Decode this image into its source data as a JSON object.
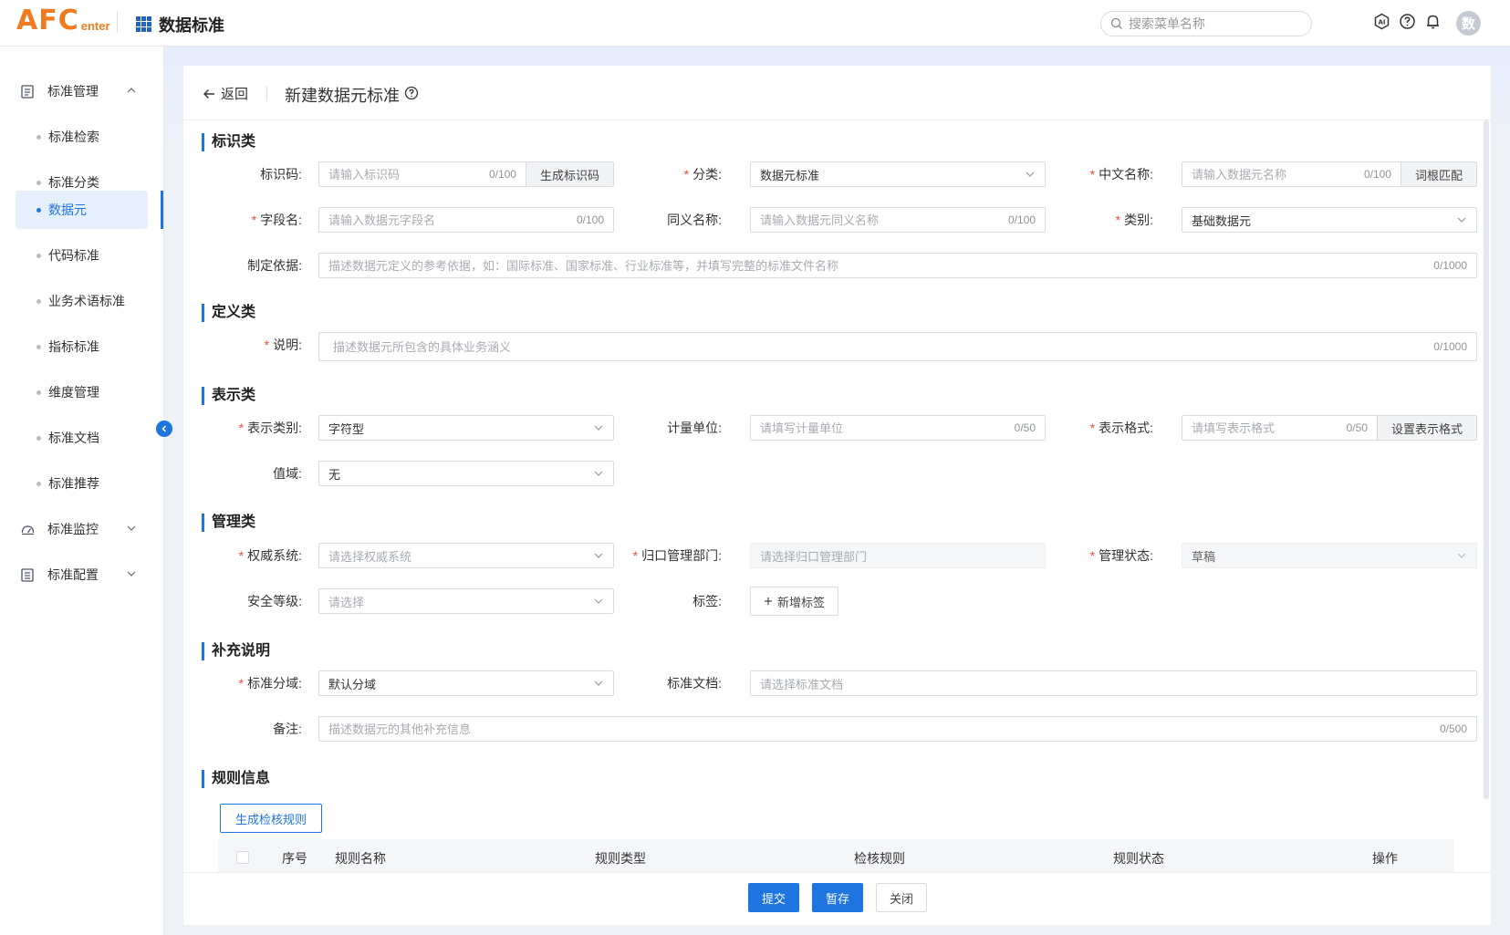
{
  "header": {
    "logo_main": "AFC",
    "logo_sub": "enter",
    "app_title": "数据标准",
    "search_placeholder": "搜索菜单名称",
    "avatar_text": "数"
  },
  "sidebar": {
    "groups": [
      {
        "label": "标准管理",
        "expanded": true
      },
      {
        "label": "标准监控",
        "expanded": false
      },
      {
        "label": "标准配置",
        "expanded": false
      }
    ],
    "items": [
      {
        "label": "标准检索",
        "active": false
      },
      {
        "label": "标准分类",
        "active": false
      },
      {
        "label": "数据元",
        "active": true
      },
      {
        "label": "代码标准",
        "active": false
      },
      {
        "label": "业务术语标准",
        "active": false
      },
      {
        "label": "指标标准",
        "active": false
      },
      {
        "label": "维度管理",
        "active": false
      },
      {
        "label": "标准文档",
        "active": false
      },
      {
        "label": "标准推荐",
        "active": false
      }
    ]
  },
  "page": {
    "back_label": "返回",
    "title": "新建数据元标准"
  },
  "sections": {
    "identify": {
      "title": "标识类",
      "code_label": "标识码:",
      "code_placeholder": "请输入标识码",
      "code_count": "0/100",
      "code_button": "生成标识码",
      "category_label": "分类:",
      "category_value": "数据元标准",
      "cn_name_label": "中文名称:",
      "cn_name_placeholder": "请输入数据元名称",
      "cn_name_count": "0/100",
      "cn_name_button": "词根匹配",
      "field_label": "字段名:",
      "field_placeholder": "请输入数据元字段名",
      "field_count": "0/100",
      "synonym_label": "同义名称:",
      "synonym_placeholder": "请输入数据元同义名称",
      "synonym_count": "0/100",
      "type_label": "类别:",
      "type_value": "基础数据元",
      "basis_label": "制定依据:",
      "basis_placeholder": "描述数据元定义的参考依据，如：国际标准、国家标准、行业标准等，并填写完整的标准文件名称",
      "basis_count": "0/1000"
    },
    "define": {
      "title": "定义类",
      "desc_label": "说明:",
      "desc_placeholder": "描述数据元所包含的具体业务涵义",
      "desc_count": "0/1000"
    },
    "represent": {
      "title": "表示类",
      "rtype_label": "表示类别:",
      "rtype_value": "字符型",
      "unit_label": "计量单位:",
      "unit_placeholder": "请填写计量单位",
      "unit_count": "0/50",
      "format_label": "表示格式:",
      "format_placeholder": "请填写表示格式",
      "format_count": "0/50",
      "format_button": "设置表示格式",
      "domain_label": "值域:",
      "domain_value": "无"
    },
    "manage": {
      "title": "管理类",
      "authority_label": "权威系统:",
      "authority_placeholder": "请选择权威系统",
      "dept_label": "归口管理部门:",
      "dept_placeholder": "请选择归口管理部门",
      "status_label": "管理状态:",
      "status_value": "草稿",
      "security_label": "安全等级:",
      "security_placeholder": "请选择",
      "tag_label": "标签:",
      "tag_button": "新增标签"
    },
    "supplement": {
      "title": "补充说明",
      "domain_label": "标准分域:",
      "domain_value": "默认分域",
      "doc_label": "标准文档:",
      "doc_placeholder": "请选择标准文档",
      "remark_label": "备注:",
      "remark_placeholder": "描述数据元的其他补充信息",
      "remark_count": "0/500"
    },
    "rules": {
      "title": "规则信息",
      "generate_button": "生成检核规则",
      "columns": [
        "序号",
        "规则名称",
        "规则类型",
        "检核规则",
        "规则状态",
        "操作"
      ]
    }
  },
  "footer": {
    "submit": "提交",
    "save": "暂存",
    "close": "关闭"
  },
  "colors": {
    "primary": "#1f75e0",
    "logo": "#f07b1f",
    "required": "#f04b3a"
  }
}
